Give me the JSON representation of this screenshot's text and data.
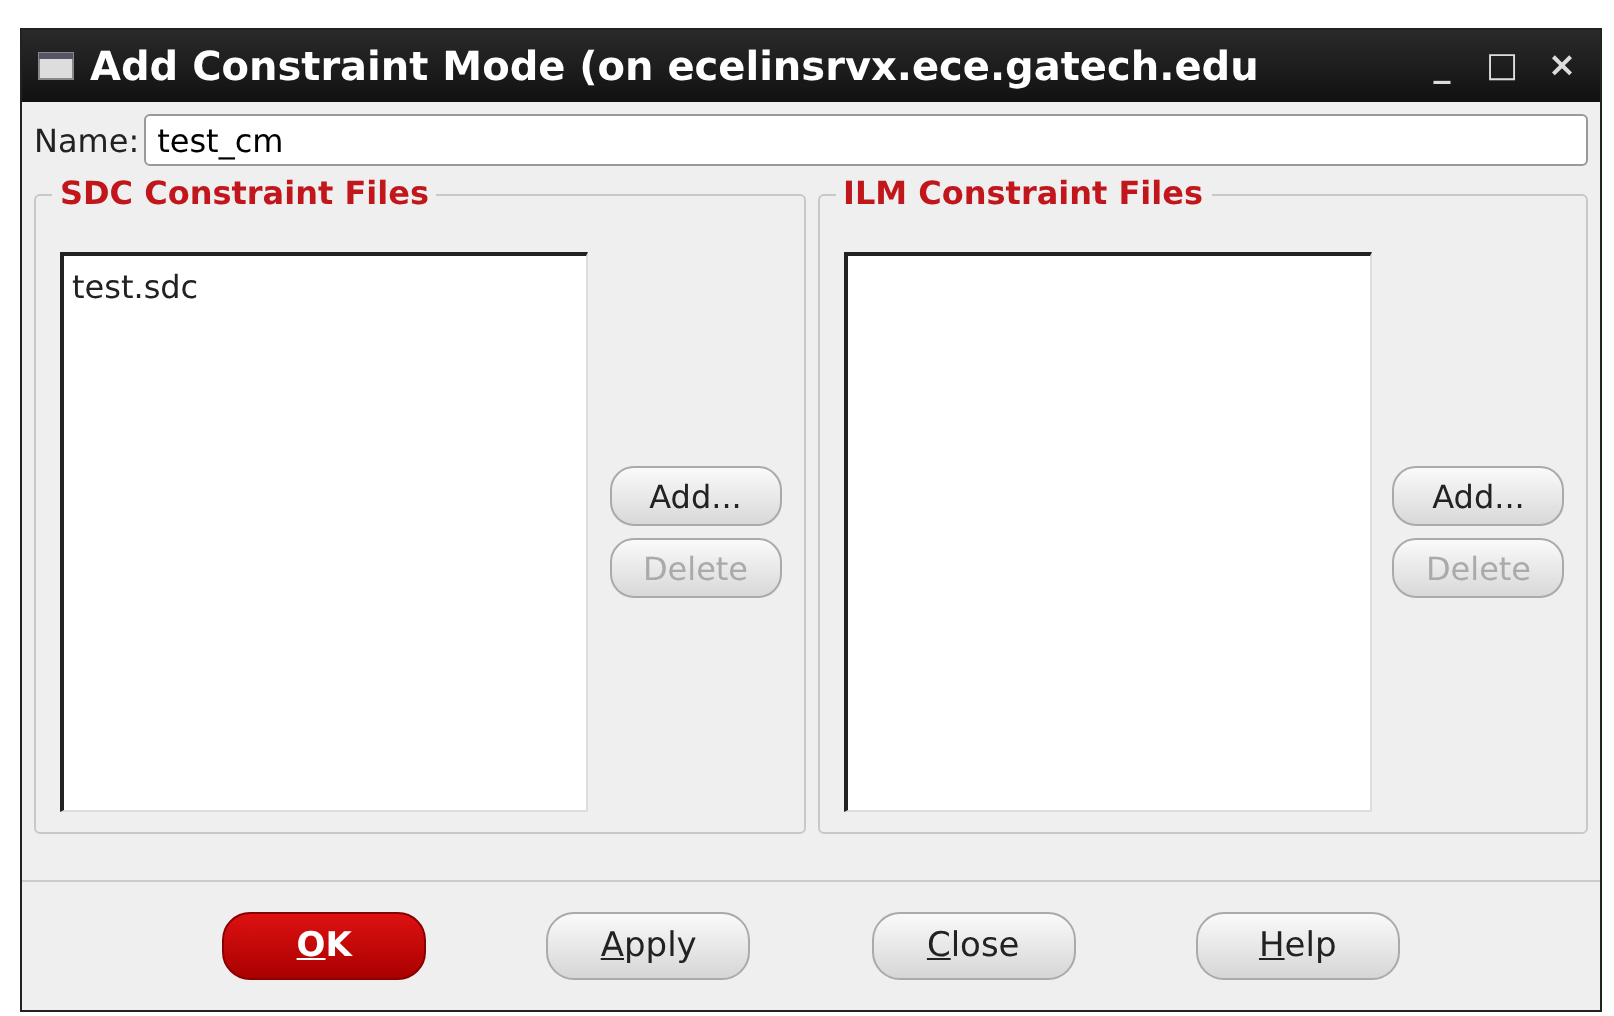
{
  "window": {
    "title": "Add Constraint Mode (on ecelinsrvx.ece.gatech.edu",
    "controls": [
      "_",
      "□",
      "×"
    ]
  },
  "name_field": {
    "label": "Name:",
    "value": "test_cm"
  },
  "groups": [
    {
      "title": "SDC Constraint Files",
      "files": [
        "test.sdc"
      ],
      "buttons": [
        {
          "label": "Add...",
          "disabled": false
        },
        {
          "label": "Delete",
          "disabled": true
        }
      ]
    },
    {
      "title": "ILM Constraint Files",
      "buttons": [
        {
          "label": "Add...",
          "disabled": false
        },
        {
          "label": "Delete",
          "disabled": true
        }
      ]
    }
  ],
  "actions": [
    {
      "mnemonic": "O",
      "rest": "K",
      "default": true
    },
    {
      "mnemonic": "A",
      "rest": "pply",
      "default": false
    },
    {
      "mnemonic": "C",
      "rest": "lose",
      "default": false
    },
    {
      "mnemonic": "H",
      "rest": "elp",
      "default": false
    }
  ]
}
